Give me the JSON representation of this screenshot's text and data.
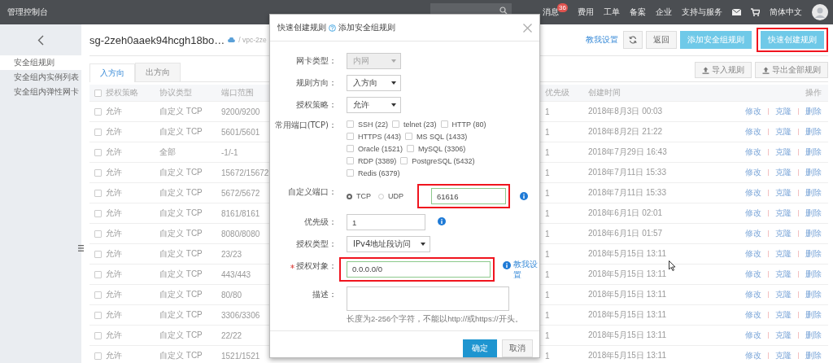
{
  "topbar": {
    "title": "管理控制台",
    "nav": [
      {
        "label": "消息",
        "badge": "36"
      },
      {
        "label": "费用"
      },
      {
        "label": "工单"
      },
      {
        "label": "备案"
      },
      {
        "label": "企业"
      },
      {
        "label": "支持与服务"
      }
    ],
    "language": "简体中文"
  },
  "sidebar": {
    "items": [
      {
        "label": "安全组规则",
        "selected": true
      },
      {
        "label": "安全组内实例列表",
        "selected": false
      },
      {
        "label": "安全组内弹性网卡",
        "selected": false
      }
    ]
  },
  "header": {
    "title": "sg-2zeh0aaek94hcgh18bo…",
    "breadcrumb": "/ vpc-2ze",
    "help_link": "教我设置",
    "back": "返回",
    "add": "添加安全组规则",
    "quick_create": {
      "label": "快速创建规则",
      "highlighted": true
    }
  },
  "tabs": [
    {
      "label": "入方向",
      "selected": true
    },
    {
      "label": "出方向",
      "selected": false
    }
  ],
  "actions": [
    "导入规则",
    "导出全部规则"
  ],
  "table": {
    "select_all_checked": false,
    "columns": [
      "授权策略",
      "协议类型",
      "端口范围",
      "优先级",
      "创建时间",
      "操作"
    ],
    "rows": [
      {
        "checked": false,
        "policy": "允许",
        "protocol": "自定义 TCP",
        "ports": "9200/9200",
        "priority": "1",
        "created": "2018年8月3日 00:03",
        "actions": [
          "修改",
          "克隆",
          "删除"
        ]
      },
      {
        "checked": false,
        "policy": "允许",
        "protocol": "自定义 TCP",
        "ports": "5601/5601",
        "priority": "1",
        "created": "2018年8月2日 21:22",
        "actions": [
          "修改",
          "克隆",
          "删除"
        ]
      },
      {
        "checked": false,
        "policy": "允许",
        "protocol": "全部",
        "ports": "-1/-1",
        "priority": "1",
        "created": "2018年7月29日 16:43",
        "actions": [
          "修改",
          "克隆",
          "删除"
        ]
      },
      {
        "checked": false,
        "policy": "允许",
        "protocol": "自定义 TCP",
        "ports": "15672/15672",
        "priority": "1",
        "created": "2018年7月11日 15:33",
        "actions": [
          "修改",
          "克隆",
          "删除"
        ]
      },
      {
        "checked": false,
        "policy": "允许",
        "protocol": "自定义 TCP",
        "ports": "5672/5672",
        "priority": "1",
        "created": "2018年7月11日 15:33",
        "actions": [
          "修改",
          "克隆",
          "删除"
        ]
      },
      {
        "checked": false,
        "policy": "允许",
        "protocol": "自定义 TCP",
        "ports": "8161/8161",
        "priority": "1",
        "created": "2018年6月1日 02:01",
        "actions": [
          "修改",
          "克隆",
          "删除"
        ]
      },
      {
        "checked": false,
        "policy": "允许",
        "protocol": "自定义 TCP",
        "ports": "8080/8080",
        "priority": "1",
        "created": "2018年6月1日 01:57",
        "actions": [
          "修改",
          "克隆",
          "删除"
        ]
      },
      {
        "checked": false,
        "policy": "允许",
        "protocol": "自定义 TCP",
        "ports": "23/23",
        "priority": "1",
        "created": "2018年5月15日 13:11",
        "actions": [
          "修改",
          "克隆",
          "删除"
        ]
      },
      {
        "checked": false,
        "policy": "允许",
        "protocol": "自定义 TCP",
        "ports": "443/443",
        "priority": "1",
        "created": "2018年5月15日 13:11",
        "actions": [
          "修改",
          "克隆",
          "删除"
        ]
      },
      {
        "checked": false,
        "policy": "允许",
        "protocol": "自定义 TCP",
        "ports": "80/80",
        "priority": "1",
        "created": "2018年5月15日 13:11",
        "actions": [
          "修改",
          "克隆",
          "删除"
        ]
      },
      {
        "checked": false,
        "policy": "允许",
        "protocol": "自定义 TCP",
        "ports": "3306/3306",
        "priority": "1",
        "created": "2018年5月15日 13:11",
        "actions": [
          "修改",
          "克隆",
          "删除"
        ]
      },
      {
        "checked": false,
        "policy": "允许",
        "protocol": "自定义 TCP",
        "ports": "22/22",
        "priority": "1",
        "created": "2018年5月15日 13:11",
        "actions": [
          "修改",
          "克隆",
          "删除"
        ]
      },
      {
        "checked": false,
        "policy": "允许",
        "protocol": "自定义 TCP",
        "ports": "1521/1521",
        "priority": "1",
        "created": "2018年5月15日 13:11",
        "actions": [
          "修改",
          "克隆",
          "删除"
        ]
      }
    ]
  },
  "dialog": {
    "title": "快速创建规则",
    "subtitle": "添加安全组规则",
    "fields": [
      {
        "kind": "select",
        "label": "网卡类型：",
        "value": "内网",
        "disabled": true,
        "required": false
      },
      {
        "kind": "select",
        "label": "规则方向：",
        "value": "入方向",
        "disabled": false,
        "required": false
      },
      {
        "kind": "select",
        "label": "授权策略：",
        "value": "允许",
        "disabled": false,
        "required": false
      },
      {
        "kind": "checkboxes",
        "label": "常用端口(TCP)：",
        "required": false,
        "options": [
          {
            "label": "SSH (22)",
            "checked": false
          },
          {
            "label": "telnet (23)",
            "checked": false
          },
          {
            "label": "HTTP (80)",
            "checked": false
          },
          {
            "label": "HTTPS (443)",
            "checked": false
          },
          {
            "label": "MS SQL (1433)",
            "checked": false
          },
          {
            "label": "Oracle (1521)",
            "checked": false
          },
          {
            "label": "MySQL (3306)",
            "checked": false
          },
          {
            "label": "RDP (3389)",
            "checked": false
          },
          {
            "label": "PostgreSQL (5432)",
            "checked": false
          },
          {
            "label": "Redis (6379)",
            "checked": false
          }
        ]
      },
      {
        "kind": "port",
        "label": "自定义端口：",
        "required": false,
        "radios": [
          {
            "label": "TCP",
            "selected": true
          },
          {
            "label": "UDP",
            "selected": false
          }
        ],
        "value": "61616",
        "highlighted": true,
        "info": true
      },
      {
        "kind": "input",
        "label": "优先级：",
        "required": false,
        "value": "1",
        "highlighted": false,
        "info": true
      },
      {
        "kind": "select",
        "label": "授权类型：",
        "value": "IPv4地址段访问",
        "disabled": false,
        "required": false
      },
      {
        "kind": "input",
        "label": "授权对象：",
        "required": true,
        "value": "0.0.0.0/0",
        "highlighted": true,
        "info": true,
        "link": "教我设置"
      },
      {
        "kind": "textarea",
        "label": "描述：",
        "required": false,
        "help": "长度为2-256个字符，不能以http://或https://开头。"
      }
    ],
    "ok": "确定",
    "cancel": "取消"
  }
}
